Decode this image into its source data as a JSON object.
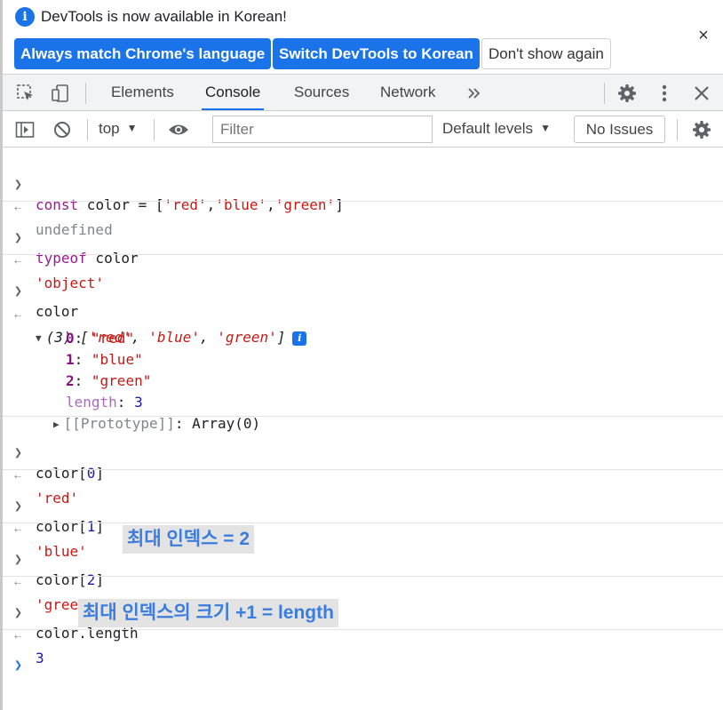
{
  "infobar": {
    "message": "DevTools is now available in Korean!",
    "btn_match": "Always match Chrome's language",
    "btn_switch": "Switch DevTools to Korean",
    "btn_dont_show": "Don't show again",
    "close": "×"
  },
  "tabs": [
    {
      "label": "Elements"
    },
    {
      "label": "Console",
      "active": true
    },
    {
      "label": "Sources"
    },
    {
      "label": "Network"
    }
  ],
  "toolbar": {
    "context": "top",
    "filter_placeholder": "Filter",
    "levels": "Default levels",
    "issues": "No Issues"
  },
  "console": {
    "e1_const": "const",
    "e1_name": " color = [",
    "e1_s1": "'red'",
    "e1_c1": ",",
    "e1_s2": "'blue'",
    "e1_c2": ",",
    "e1_s3": "'green'",
    "e1_end": "]",
    "e1_result": "undefined",
    "e2_typeof": "typeof",
    "e2_name": " color",
    "e2_result": "'object'",
    "e3_input": "color",
    "e3_count": "(3) [",
    "e3_v1": "'red'",
    "e3_sep1": ", ",
    "e3_v2": "'blue'",
    "e3_sep2": ", ",
    "e3_v3": "'green'",
    "e3_end": "]",
    "e3_badge": "i",
    "e3_k0": "0",
    "e3_d0": "\"red\"",
    "e3_k1": "1",
    "e3_d1": "\"blue\"",
    "e3_k2": "2",
    "e3_d2": "\"green\"",
    "e3_klen": "length",
    "e3_dlen": "3",
    "e3_proto_key": "[[Prototype]]",
    "e3_proto_val": ": Array(0)",
    "colon": ": ",
    "e4_input_a": "color[",
    "e4_idx": "0",
    "e4_input_b": "]",
    "e4_result": "'red'",
    "e5_input_a": "color[",
    "e5_idx": "1",
    "e5_input_b": "]",
    "e5_result": "'blue'",
    "e6_input_a": "color[",
    "e6_idx": "2",
    "e6_input_b": "]",
    "e6_result": "'green'",
    "e7_input": "color.length",
    "e7_result": "3"
  },
  "annotations": {
    "note1": "최대 인덱스 = 2",
    "note2": "최대 인덱스의 크기 +1 = length"
  },
  "colors": {
    "accent": "#1a73e8",
    "keyword": "#9a1b8d",
    "string": "#c41a16",
    "number": "#1a1aa6",
    "annotation_text": "#3b7ddd",
    "annotation_bg": "#e3e3e3"
  },
  "icons": {
    "info": "info-icon",
    "close": "close-icon",
    "inspect": "inspect-icon",
    "device": "device-toggle-icon",
    "more_tabs": "more-tabs-icon",
    "settings": "gear-icon",
    "kebab": "kebab-menu-icon",
    "sidebar": "sidebar-toggle-icon",
    "clear": "clear-console-icon",
    "eye": "eye-icon"
  }
}
